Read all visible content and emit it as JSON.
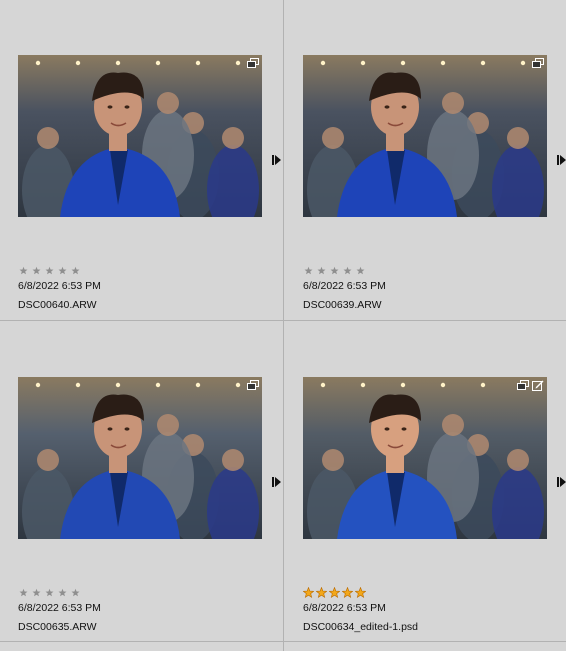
{
  "thumbnails": [
    {
      "date": "6/8/2022 6:53 PM",
      "filename": "DSC00640.ARW",
      "rating": 0,
      "stack_icon": "stack-icon",
      "edited_icon": null,
      "colors": {
        "bg": "#4a5260",
        "shirt": "#1e44b8",
        "skin": "#c89478",
        "hair": "#2a1d16"
      }
    },
    {
      "date": "6/8/2022 6:53 PM",
      "filename": "DSC00639.ARW",
      "rating": 0,
      "stack_icon": "stack-icon",
      "edited_icon": null,
      "colors": {
        "bg": "#4a5260",
        "shirt": "#1e44b8",
        "skin": "#c89478",
        "hair": "#2a1d16"
      }
    },
    {
      "date": "6/8/2022 6:53 PM",
      "filename": "DSC00635.ARW",
      "rating": 0,
      "stack_icon": "stack-icon",
      "edited_icon": null,
      "colors": {
        "bg": "#55606e",
        "shirt": "#2249b4",
        "skin": "#c89478",
        "hair": "#2a1d16"
      }
    },
    {
      "date": "6/8/2022 6:53 PM",
      "filename": "DSC00634_edited-1.psd",
      "rating": 5,
      "stack_icon": "stack-icon",
      "edited_icon": "edited-icon",
      "colors": {
        "bg": "#535c66",
        "shirt": "#2452c0",
        "skin": "#d7a07f",
        "hair": "#2a1d16"
      }
    }
  ],
  "colors": {
    "panel_bg": "#d6d6d6",
    "divider": "#b2b2b2",
    "star_empty": "#8f8f8f",
    "star_filled": "#f3a81a",
    "text": "#111111"
  }
}
